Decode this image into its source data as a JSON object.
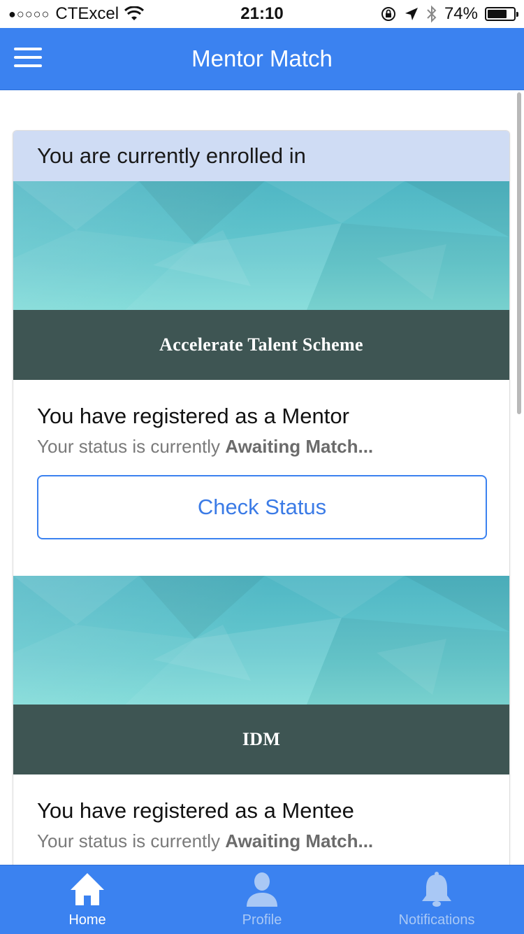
{
  "status_bar": {
    "signal": "●○○○○",
    "carrier": "CTExcel",
    "time": "21:10",
    "battery_percent": "74%",
    "battery_level": 0.74
  },
  "nav": {
    "title": "Mentor Match"
  },
  "card": {
    "header": "You are currently enrolled in",
    "enrollments": [
      {
        "scheme_name": "Accelerate Talent Scheme",
        "role_text": "You have registered as a Mentor",
        "status_prefix": "Your status is currently",
        "status_value": "Awaiting Match...",
        "button_label": "Check Status"
      },
      {
        "scheme_name": "IDM",
        "role_text": "You have registered as a Mentee",
        "status_prefix": "Your status is currently",
        "status_value": "Awaiting Match..."
      }
    ]
  },
  "tabs": [
    {
      "label": "Home",
      "icon": "home-icon",
      "active": true
    },
    {
      "label": "Profile",
      "icon": "person-icon",
      "active": false
    },
    {
      "label": "Notifications",
      "icon": "bell-icon",
      "active": false
    }
  ],
  "colors": {
    "primary": "#3b82f0",
    "header_bg": "#cfdcf4",
    "banner_caption_bg": "#3e5553",
    "teal_light": "#80dcd8"
  }
}
